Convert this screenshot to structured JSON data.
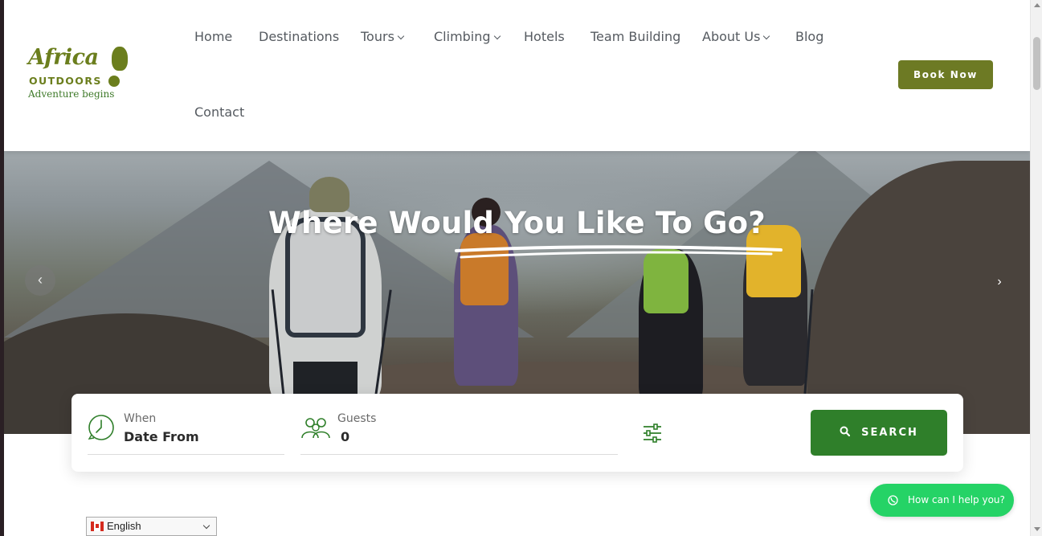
{
  "header": {
    "logo": {
      "line1": "Africa",
      "line2": "OUTDOORS",
      "line3": "Adventure begins"
    },
    "nav": [
      {
        "label": "Home",
        "has_dropdown": false
      },
      {
        "label": "Destinations",
        "has_dropdown": false
      },
      {
        "label": "Tours",
        "has_dropdown": true
      },
      {
        "label": "Climbing",
        "has_dropdown": true
      },
      {
        "label": "Hotels",
        "has_dropdown": false
      },
      {
        "label": "Team Building",
        "has_dropdown": false
      },
      {
        "label": "About Us",
        "has_dropdown": true
      },
      {
        "label": "Blog",
        "has_dropdown": false
      },
      {
        "label": "Contact",
        "has_dropdown": false
      }
    ],
    "book_label": "Book Now"
  },
  "hero": {
    "title": "Where Would You Like To Go?",
    "prev_icon": "‹",
    "next_icon": "›"
  },
  "search": {
    "when_label": "When",
    "when_value": "Date From",
    "guests_label": "Guests",
    "guests_value": "0",
    "button_label": "SEARCH"
  },
  "whatsapp": {
    "label": "How can I help you?"
  },
  "language": {
    "selected": "English"
  },
  "colors": {
    "brand_olive": "#6d7a24",
    "search_green": "#2f7f2a",
    "whatsapp_green": "#25d366",
    "nav_text": "#555a60"
  },
  "icons": {
    "when": "clock-icon",
    "guests": "group-icon",
    "filter": "sliders-icon",
    "search": "search-icon",
    "whatsapp": "whatsapp-icon",
    "flag": "canada-flag-icon"
  }
}
